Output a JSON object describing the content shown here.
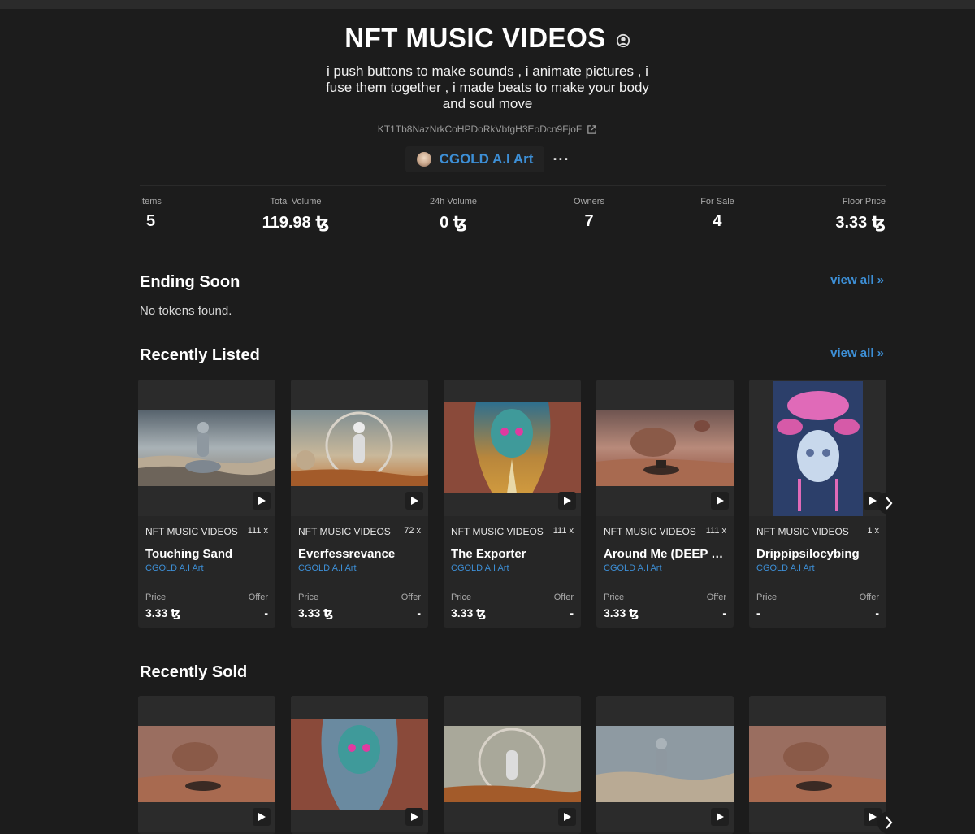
{
  "collection": {
    "title": "NFT MUSIC VIDEOS",
    "description": "i push buttons to make sounds , i animate pictures , i fuse them together , i made beats to make your body and soul move",
    "address": "KT1Tb8NazNrkCoHPDoRkVbfgH3EoDcn9FjoF",
    "creator": "CGOLD A.I Art",
    "more_label": "···"
  },
  "stats": {
    "items": {
      "label": "Items",
      "value": "5"
    },
    "total_volume": {
      "label": "Total Volume",
      "value": "119.98 ꜩ"
    },
    "volume_24h": {
      "label": "24h Volume",
      "value": "0 ꜩ"
    },
    "owners": {
      "label": "Owners",
      "value": "7"
    },
    "for_sale": {
      "label": "For Sale",
      "value": "4"
    },
    "floor_price": {
      "label": "Floor Price",
      "value": "3.33 ꜩ"
    }
  },
  "ending_soon": {
    "title": "Ending Soon",
    "view_all": "view all »",
    "empty": "No tokens found."
  },
  "recently_listed": {
    "title": "Recently Listed",
    "view_all": "view all »",
    "cards": [
      {
        "collection": "NFT MUSIC VIDEOS",
        "editions": "111 x",
        "name": "Touching Sand",
        "creator": "CGOLD A.I Art",
        "price_label": "Price",
        "offer_label": "Offer",
        "price": "3.33 ꜩ",
        "offer": "-"
      },
      {
        "collection": "NFT MUSIC VIDEOS",
        "editions": "72 x",
        "name": "Everfessrevance",
        "creator": "CGOLD A.I Art",
        "price_label": "Price",
        "offer_label": "Offer",
        "price": "3.33 ꜩ",
        "offer": "-"
      },
      {
        "collection": "NFT MUSIC VIDEOS",
        "editions": "111 x",
        "name": "The Exporter",
        "creator": "CGOLD A.I Art",
        "price_label": "Price",
        "offer_label": "Offer",
        "price": "3.33 ꜩ",
        "offer": "-"
      },
      {
        "collection": "NFT MUSIC VIDEOS",
        "editions": "111 x",
        "name": "Around Me (DEEP H...",
        "creator": "CGOLD A.I Art",
        "price_label": "Price",
        "offer_label": "Offer",
        "price": "3.33 ꜩ",
        "offer": "-"
      },
      {
        "collection": "NFT MUSIC VIDEOS",
        "editions": "1 x",
        "name": "Drippipsilocybing",
        "creator": "CGOLD A.I Art",
        "price_label": "Price",
        "offer_label": "Offer",
        "price": "-",
        "offer": "-"
      }
    ]
  },
  "recently_sold": {
    "title": "Recently Sold"
  },
  "icons": {
    "profile": "user-circle-icon",
    "external_link": "external-link-icon",
    "play": "play-icon",
    "next": "chevron-right-icon"
  },
  "colors": {
    "background": "#1c1c1c",
    "card": "#262626",
    "accent": "#3d8fd6"
  }
}
